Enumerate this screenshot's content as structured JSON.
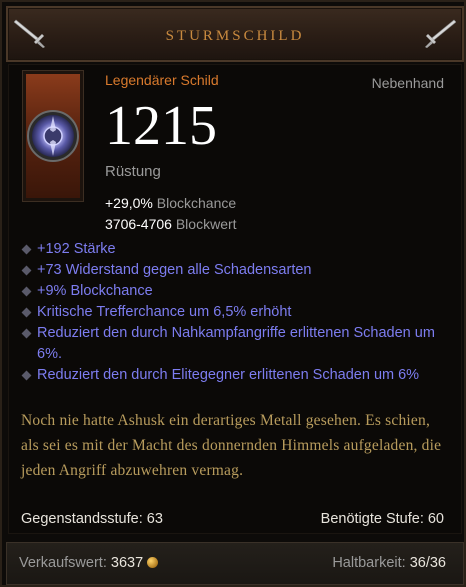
{
  "header": {
    "title": "STURMSCHILD"
  },
  "item": {
    "type": "Legendärer Schild",
    "slot": "Nebenhand",
    "armor_value": "1215",
    "armor_label": "Rüstung",
    "block_chance_value": "+29,0%",
    "block_chance_label": "Blockchance",
    "block_value_value": "3706-4706",
    "block_value_label": "Blockwert"
  },
  "properties": [
    "+192 Stärke",
    "+73 Widerstand gegen alle Schadensarten",
    "+9% Blockchance",
    "Kritische Trefferchance um 6,5% erhöht",
    "Reduziert den durch Nahkampfangriffe erlittenen Schaden um 6%.",
    "Reduziert den durch Elitegegner erlittenen Schaden um 6%"
  ],
  "flavor_text": "Noch nie hatte Ashusk ein derartiges Metall gesehen. Es schien, als sei es mit der Macht des donnernden Himmels aufgeladen, die jeden Angriff abzuwehren vermag.",
  "levels": {
    "item_level_label": "Gegenstandsstufe: 63",
    "required_level_label": "Benötigte Stufe: 60"
  },
  "footer": {
    "sell_label": "Verkaufswert:",
    "sell_value": "3637",
    "durability_label": "Haltbarkeit:",
    "durability_value": "36/36"
  },
  "colors": {
    "legendary": "#d97a2d",
    "affix": "#7d7df0",
    "flavor": "#b89c5d"
  },
  "icons": {
    "corner_left": "sword-icon",
    "corner_right": "sword-icon",
    "item": "shield-icon",
    "gold": "gold-coin-icon"
  }
}
